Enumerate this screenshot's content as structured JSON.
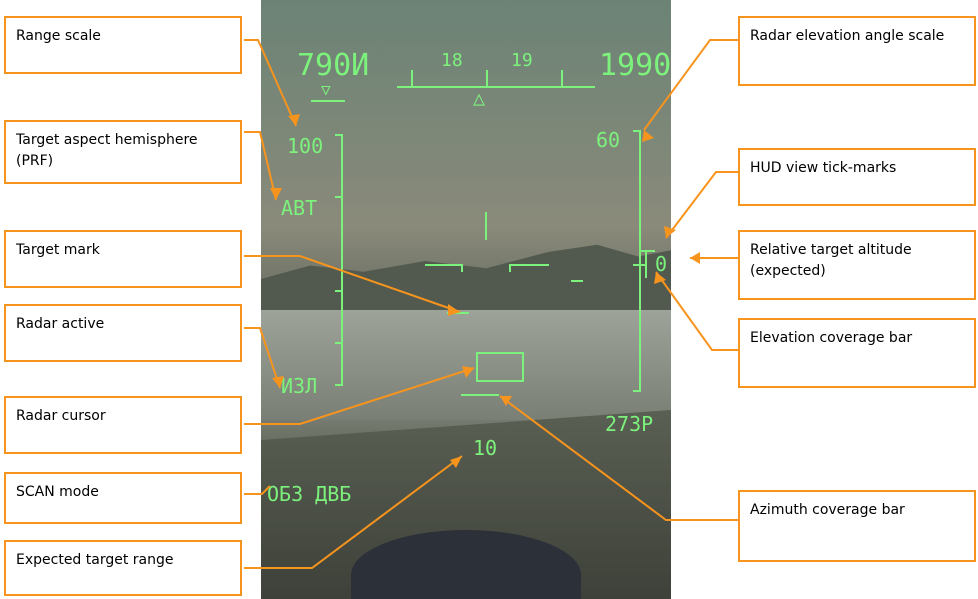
{
  "callouts": {
    "range_scale": "Range scale",
    "target_aspect": "Target aspect hemisphere (PRF)",
    "target_mark": "Target mark",
    "radar_active": "Radar active",
    "radar_cursor": "Radar cursor",
    "scan_mode": "SCAN mode",
    "expected_range": "Expected target range",
    "radar_elev_scale": "Radar elevation angle scale",
    "hud_ticks": "HUD view tick-marks",
    "rel_alt": "Relative target altitude (expected)",
    "elev_bar": "Elevation coverage bar",
    "azim_bar": "Azimuth coverage bar"
  },
  "hud": {
    "airspeed": "790И",
    "altitude": "1990",
    "heading_18": "18",
    "heading_19": "19",
    "range_max": "100",
    "prf": "АВТ",
    "radar_mode": "ИЗЛ",
    "elev_max": "60",
    "rel_alt": "0",
    "elev_readout": "273Р",
    "scan": "ОБЗ ДВБ",
    "range_value": "10"
  },
  "colors": {
    "hud": "#7cf27c",
    "callout": "#f7941d"
  }
}
